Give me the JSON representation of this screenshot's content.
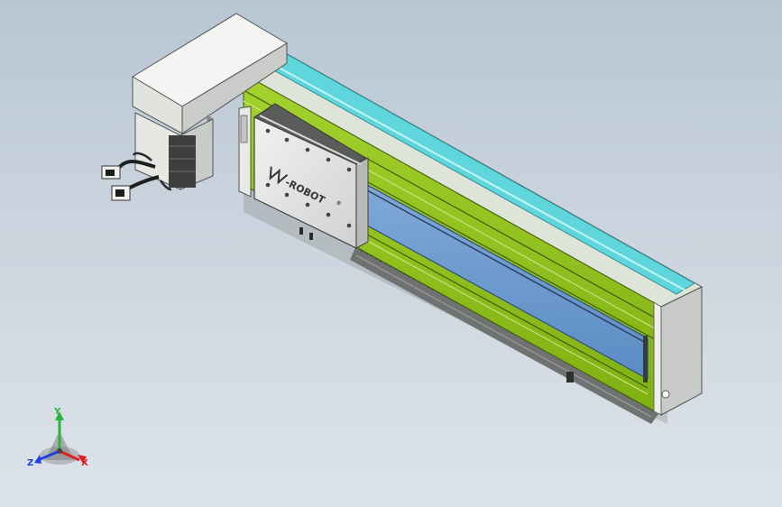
{
  "logo": {
    "text": "-ROBOT",
    "reg": "®"
  },
  "triad": {
    "y_label": "Y",
    "x_label": "X",
    "z_label": "Z"
  },
  "colors": {
    "rail_green": "#8ec21c",
    "cover_cyan": "#5fd6dc",
    "window_blue": "#6f9fd2",
    "housing_grey": "#e3e5e2",
    "background_top": "#b8c6d3"
  },
  "icons": [
    "coordinate-triad-icon",
    "robot-logo-icon"
  ]
}
